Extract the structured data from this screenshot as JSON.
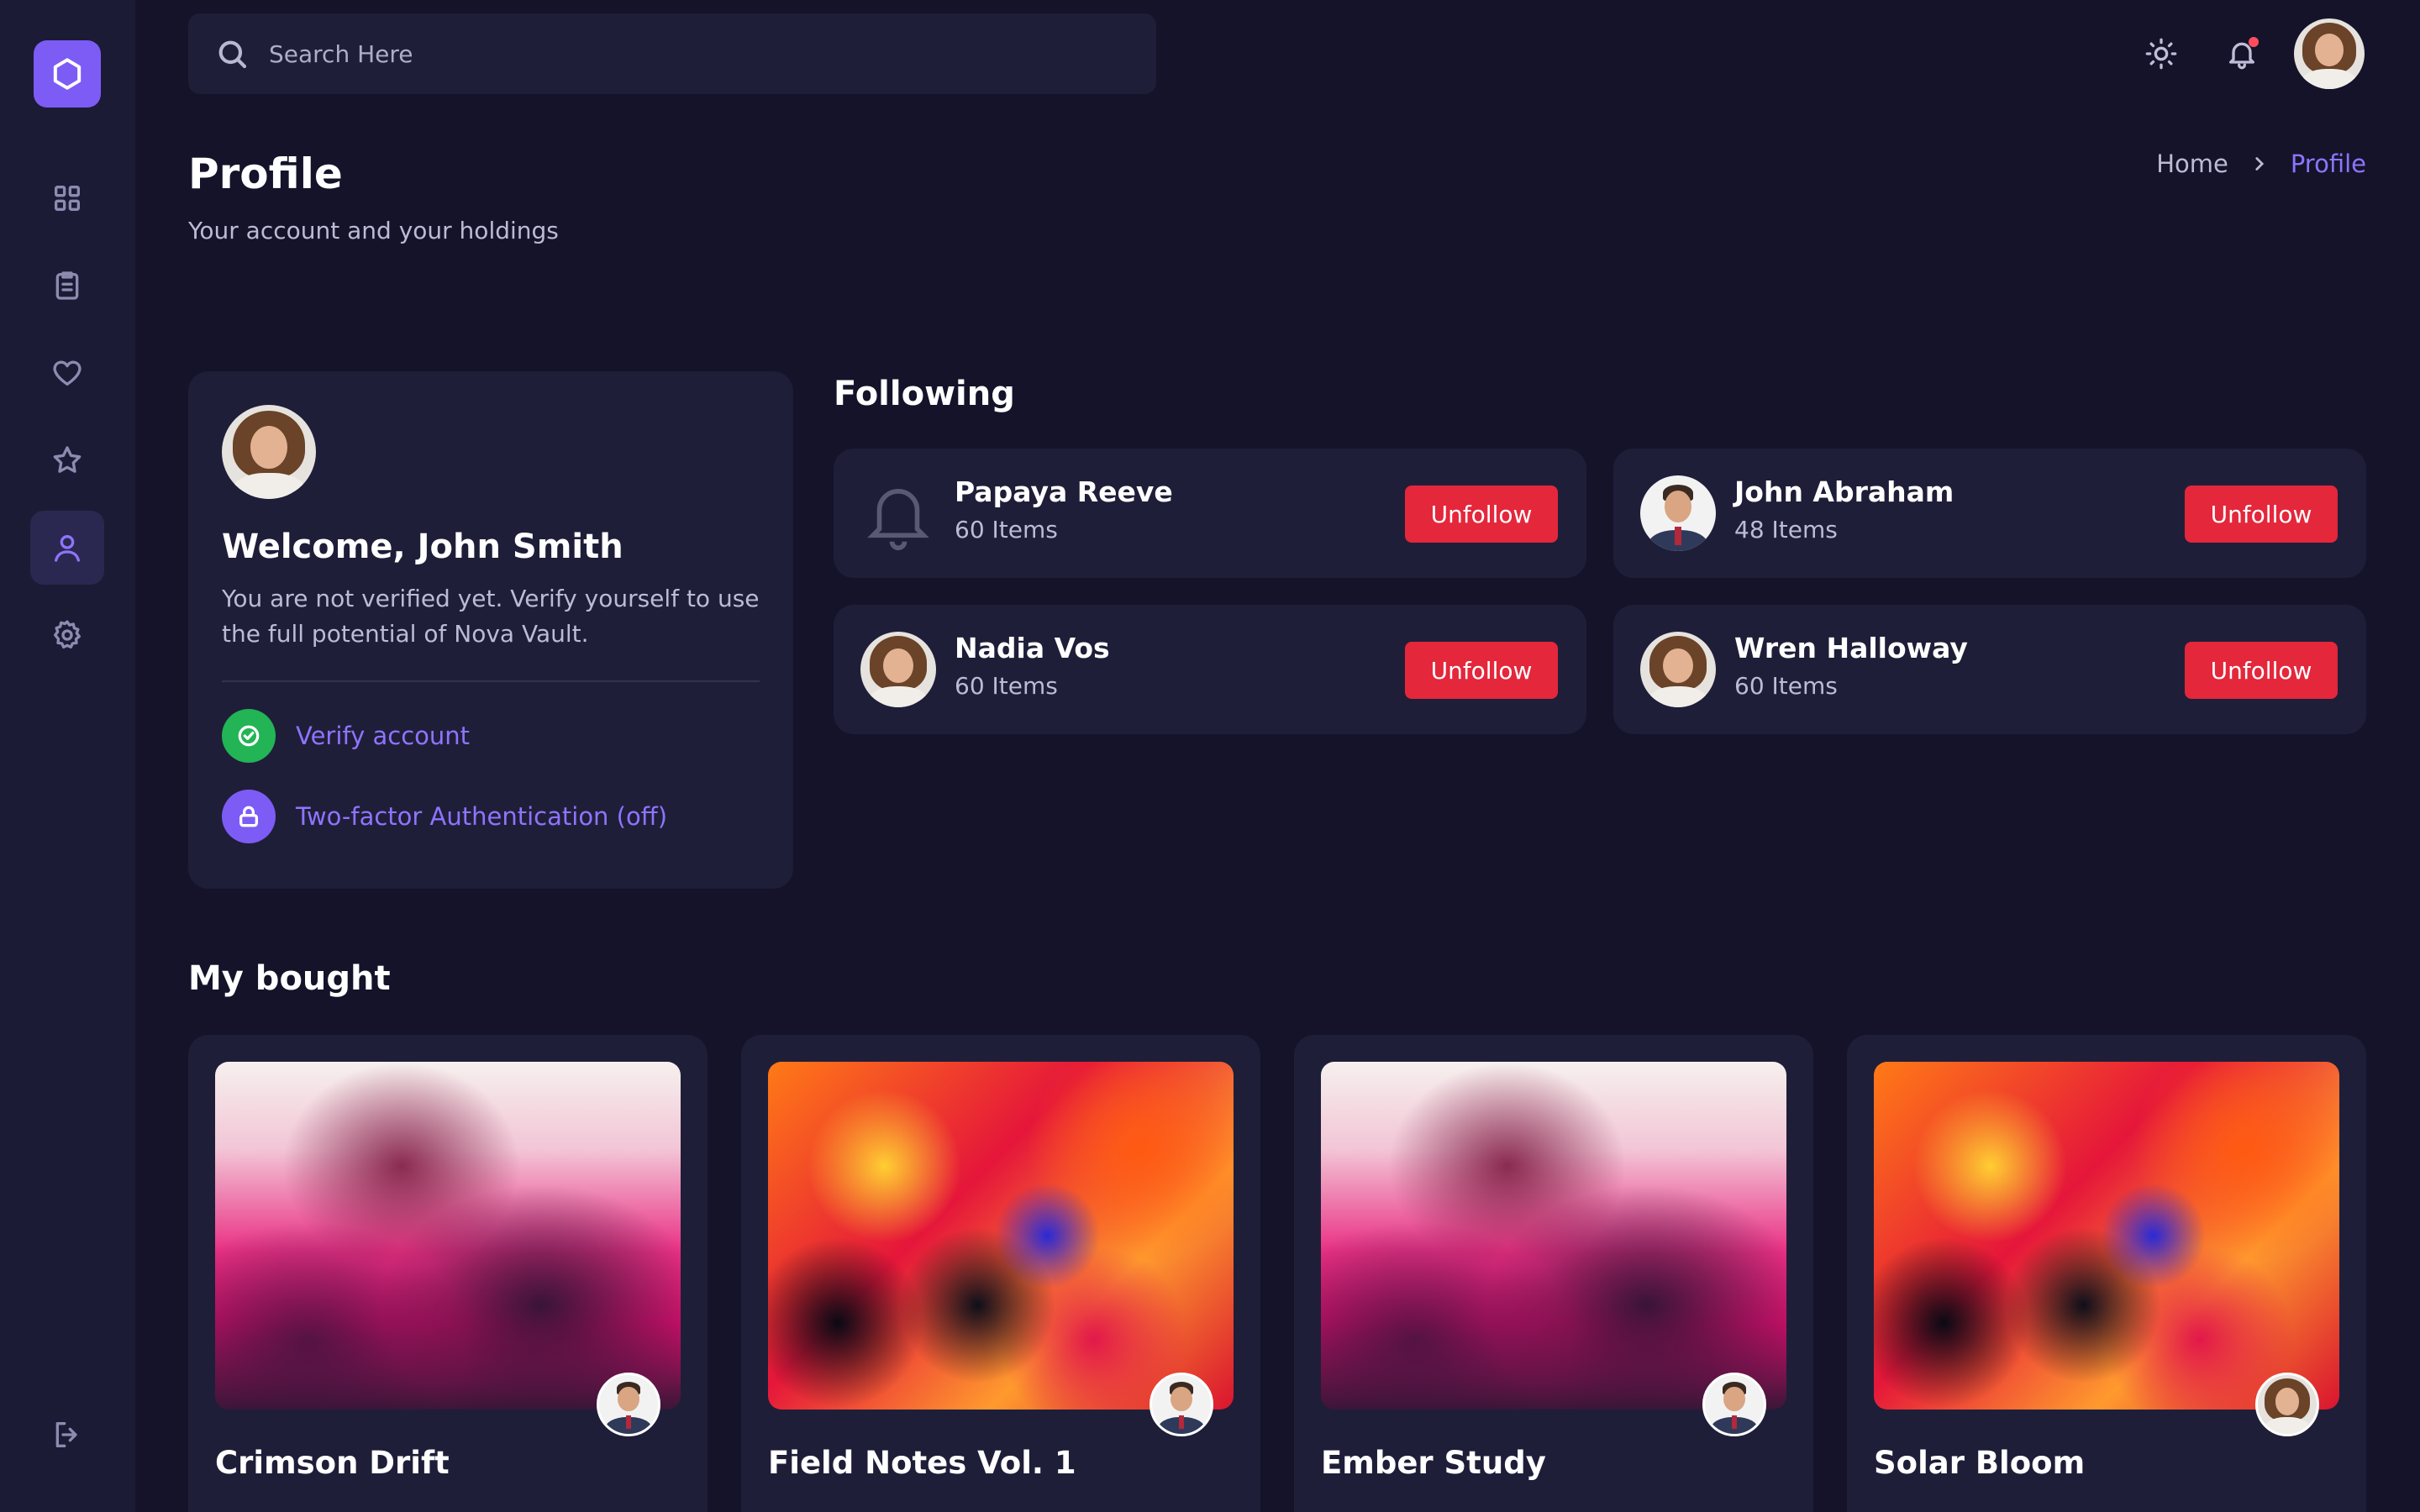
{
  "search": {
    "placeholder": "Search Here"
  },
  "header": {
    "title": "Profile",
    "subtitle": "Your account and your holdings"
  },
  "breadcrumb": {
    "home": "Home",
    "current": "Profile"
  },
  "profile": {
    "welcome": "Welcome, John Smith",
    "description": "You are not verified yet. Verify yourself to use the full potential of Nova Vault.",
    "actions": [
      {
        "label": "Verify account",
        "icon": "check-circle-icon",
        "color": "#22b455"
      },
      {
        "label": "Two-factor Authentication (off)",
        "icon": "lock-icon",
        "color": "#7c5cf5"
      }
    ]
  },
  "following": {
    "title": "Following",
    "button_label": "Unfollow",
    "items": [
      {
        "name": "Papaya Reeve",
        "count": "60 Items"
      },
      {
        "name": "John Abraham",
        "count": "48 Items"
      },
      {
        "name": "Nadia Vos",
        "count": "60 Items"
      },
      {
        "name": "Wren Halloway",
        "count": "60 Items"
      }
    ]
  },
  "bought": {
    "title": "My bought",
    "items": [
      {
        "title": "Crimson Drift"
      },
      {
        "title": "Field Notes Vol. 1"
      },
      {
        "title": "Ember Study"
      },
      {
        "title": "Solar Bloom"
      }
    ]
  },
  "colors": {
    "accent": "#8e74ff",
    "danger": "#e4273b",
    "background": "#14132a",
    "card": "#1f1e39"
  }
}
